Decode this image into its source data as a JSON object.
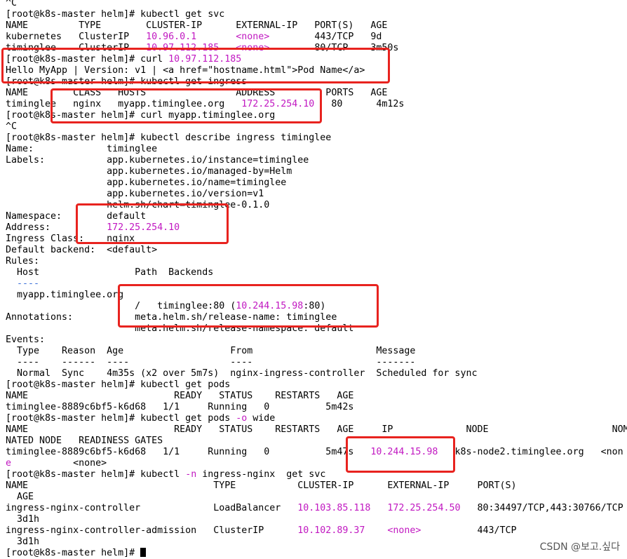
{
  "colors": {
    "background": "#ffffff",
    "text": "#000000",
    "highlight": "#c118c1",
    "annotation_box": "#e8231f",
    "watermark": "#555555"
  },
  "terminal": {
    "lines": [
      [
        {
          "t": "^C"
        }
      ],
      [
        {
          "t": "[root@k8s-master helm]# kubectl get svc"
        }
      ],
      [
        {
          "t": "NAME         TYPE        CLUSTER-IP      EXTERNAL-IP   PORT(S)   AGE"
        }
      ],
      [
        {
          "t": "kubernetes   ClusterIP   "
        },
        {
          "t": "10.96.0.1",
          "c": "m"
        },
        {
          "t": "       "
        },
        {
          "t": "<none>",
          "c": "m"
        },
        {
          "t": "        443/TCP   9d"
        }
      ],
      [
        {
          "t": "timinglee    ClusterIP   "
        },
        {
          "t": "10.97.112.185",
          "c": "m"
        },
        {
          "t": "   "
        },
        {
          "t": "<none>",
          "c": "m"
        },
        {
          "t": "        80/TCP    3m50s"
        }
      ],
      [
        {
          "t": "[root@k8s-master helm]# curl "
        },
        {
          "t": "10.97.112.185",
          "c": "m"
        }
      ],
      [
        {
          "t": "Hello MyApp | Version: v1 | <a href=\"hostname.html\">Pod Name</a>"
        }
      ],
      [
        {
          "t": "[root@k8s-master helm]# kubectl get ingress"
        }
      ],
      [
        {
          "t": "NAME        CLASS   HOSTS                ADDRESS         PORTS   AGE"
        }
      ],
      [
        {
          "t": "timinglee   nginx   myapp.timinglee.org   "
        },
        {
          "t": "172.25.254.10",
          "c": "m"
        },
        {
          "t": "   80      4m12s"
        }
      ],
      [
        {
          "t": "[root@k8s-master helm]# curl myapp.timinglee.org"
        }
      ],
      [
        {
          "t": "^C"
        }
      ],
      [
        {
          "t": "[root@k8s-master helm]# kubectl describe ingress timinglee"
        }
      ],
      [
        {
          "t": "Name:             timinglee"
        }
      ],
      [
        {
          "t": "Labels:           app.kubernetes.io/instance=timinglee"
        }
      ],
      [
        {
          "t": "                  app.kubernetes.io/managed-by=Helm"
        }
      ],
      [
        {
          "t": "                  app.kubernetes.io/name=timinglee"
        }
      ],
      [
        {
          "t": "                  app.kubernetes.io/version=v1"
        }
      ],
      [
        {
          "t": "                  helm.sh/chart=timinglee-0.1.0"
        }
      ],
      [
        {
          "t": "Namespace:        default"
        }
      ],
      [
        {
          "t": "Address:          "
        },
        {
          "t": "172.25.254.10",
          "c": "m"
        }
      ],
      [
        {
          "t": "Ingress Class:    nginx"
        }
      ],
      [
        {
          "t": "Default backend:  <default>"
        }
      ],
      [
        {
          "t": "Rules:"
        }
      ],
      [
        {
          "t": "  Host                 Path  Backends"
        }
      ],
      [
        {
          "t": "  ----                ",
          "c": ""
        },
        {
          "t": "",
          "c": ""
        }
      ],
      [
        {
          "t": "  myapp.timinglee.org"
        }
      ],
      [
        {
          "t": "                       /   timinglee:80 ("
        },
        {
          "t": "10.244.15.98",
          "c": "m"
        },
        {
          "t": ":80)"
        }
      ],
      [
        {
          "t": "Annotations:           meta.helm.sh/release-name: timinglee"
        }
      ],
      [
        {
          "t": "                       meta.helm.sh/release-namespace: default"
        }
      ],
      [
        {
          "t": "Events:"
        }
      ],
      [
        {
          "t": "  Type    Reason  Age                   From                      Message"
        }
      ],
      [
        {
          "t": "  ----    ------  ----                  ----                      -------"
        }
      ],
      [
        {
          "t": "  Normal  Sync    4m35s (x2 over 5m7s)  nginx-ingress-controller  Scheduled for sync"
        }
      ],
      [
        {
          "t": "[root@k8s-master helm]# kubectl get pods"
        }
      ],
      [
        {
          "t": "NAME                          READY   STATUS    RESTARTS   AGE"
        }
      ],
      [
        {
          "t": "timinglee-8889c6bf5-k6d68   1/1     Running   0          5m42s"
        }
      ],
      [
        {
          "t": "[root@k8s-master helm]# kubectl get pods "
        },
        {
          "t": "-o",
          "c": "m"
        },
        {
          "t": " wide"
        }
      ],
      [
        {
          "t": "NAME                          READY   STATUS    RESTARTS   AGE     IP             NODE                      NOMI"
        }
      ],
      [
        {
          "t": "NATED NODE   READINESS GATES"
        }
      ],
      [
        {
          "t": "timinglee-8889c6bf5-k6d68   1/1     Running   0          5m47s   "
        },
        {
          "t": "10.244.15.98",
          "c": "m"
        },
        {
          "t": "   k8s-node2.timinglee.org   <non"
        }
      ],
      [
        {
          "t": "e",
          "c": "m"
        },
        {
          "t": "           <none>"
        }
      ],
      [
        {
          "t": "[root@k8s-master helm]# kubectl "
        },
        {
          "t": "-n",
          "c": "m"
        },
        {
          "t": " ingress-nginx  get svc"
        }
      ],
      [
        {
          "t": "NAME                                 TYPE           CLUSTER-IP      EXTERNAL-IP     PORT(S)"
        }
      ],
      [
        {
          "t": "  AGE"
        }
      ],
      [
        {
          "t": "ingress-nginx-controller             LoadBalancer   "
        },
        {
          "t": "10.103.85.118",
          "c": "m"
        },
        {
          "t": "   "
        },
        {
          "t": "172.25.254.50",
          "c": "m"
        },
        {
          "t": "   80:34497/TCP,443:30766/TCP"
        }
      ],
      [
        {
          "t": "  3d1h"
        }
      ],
      [
        {
          "t": "ingress-nginx-controller-admission   ClusterIP      "
        },
        {
          "t": "10.102.89.37",
          "c": "m"
        },
        {
          "t": "    "
        },
        {
          "t": "<none>",
          "c": "m"
        },
        {
          "t": "          443/TCP"
        }
      ],
      [
        {
          "t": "  3d1h"
        }
      ],
      [
        {
          "t": "[root@k8s-master helm]# "
        }
      ]
    ]
  },
  "watermark": "CSDN @보고.싶다"
}
